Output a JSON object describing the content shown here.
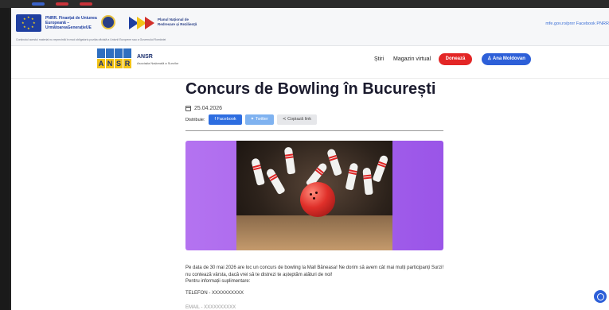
{
  "funding": {
    "program": "PNRR. Finanțat de Uniunea Europeană – UrmătoareaGenerațieUE",
    "pnrr": "Planul Național de Redresare și Reziliență",
    "links": "mfe.gov.ro/pnrr   Facebook PNRR",
    "disclaimer": "Conținutul acestui material nu reprezintă în mod obligatoriu poziția oficială a Uniunii Europene sau a Guvernului României"
  },
  "header": {
    "logo_letters": [
      "A",
      "N",
      "S",
      "R"
    ],
    "logo_name": "ANSR",
    "logo_sub": "Asociația Națională a Surzilor",
    "nav": [
      "Știri",
      "Magazin virtual"
    ],
    "donate_label": "Donează",
    "user_label": "Ana Moldovan"
  },
  "article": {
    "title": "Concurs de Bowling în București",
    "date": "25.04.2026",
    "share_label": "Distribuie:",
    "share_facebook": "Facebook",
    "share_twitter": "Twitter",
    "share_copy": "Copiază link",
    "body": "Pe data de 30 mai 2026 are loc un concurs de bowling la Mall Băneasa! Ne dorim să avem cât mai mulți participanți Surzi! nu contează vârsta, dacă vrei să te distrezi te așteptăm alături de noi!",
    "info_label": "Pentru informații suplimentare:",
    "phone": "TELEFON - XXXXXXXXXX",
    "phone2": "EMAIL - XXXXXXXXXX"
  },
  "colors": {
    "donate": "#e32626",
    "primary": "#2d5fd8",
    "hero": "#9a55e8"
  },
  "icons": {
    "calendar": "calendar-icon",
    "facebook": "facebook-icon",
    "twitter": "twitter-icon",
    "link": "link-icon",
    "user": "user-icon",
    "chat": "chat-icon"
  }
}
